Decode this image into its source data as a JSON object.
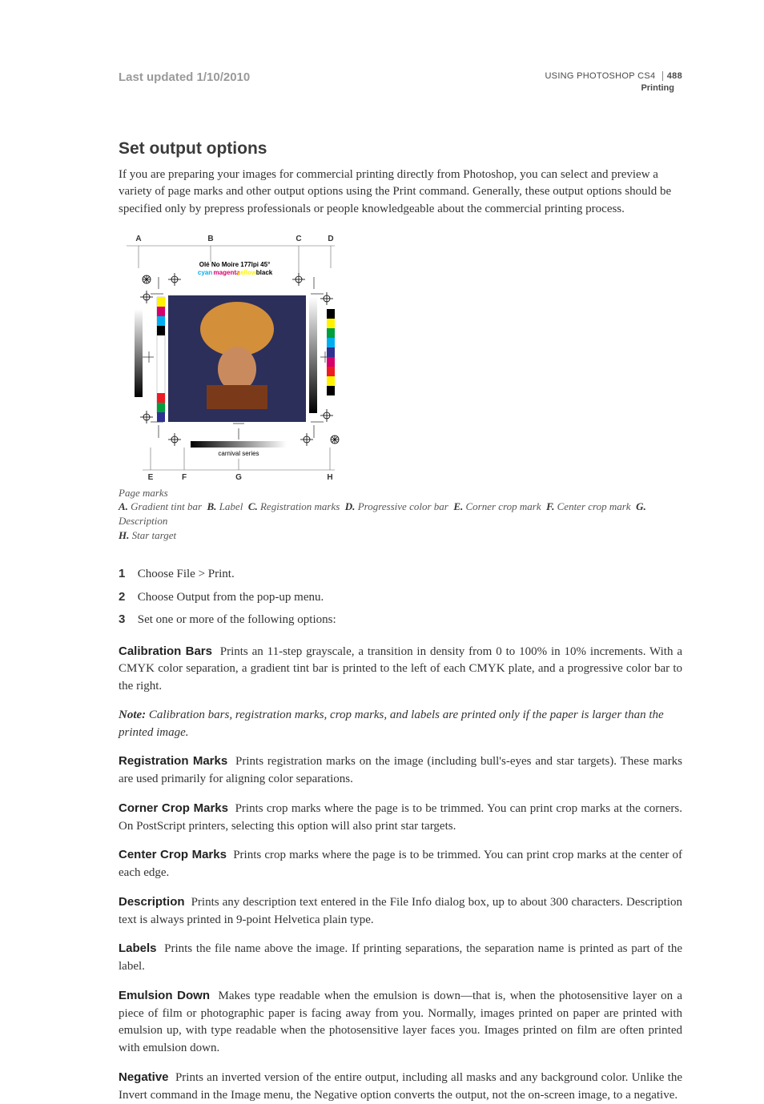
{
  "header": {
    "updated": "Last updated 1/10/2010",
    "doc_title": "USING PHOTOSHOP CS4",
    "page_number": "488",
    "section": "Printing"
  },
  "title": "Set output options",
  "intro": "If you are preparing your images for commercial printing directly from Photoshop, you can select and preview a variety of page marks and other output options using the Print command. Generally, these output options should be specified only by prepress professionals or people knowledgeable about the commercial printing process.",
  "figure": {
    "callouts_top": {
      "A": "A",
      "B": "B",
      "C": "C",
      "D": "D"
    },
    "callouts_bottom": {
      "E": "E",
      "F": "F",
      "G": "G",
      "H": "H"
    },
    "label_top": "Olé No Moire    177lpi   45°",
    "cmyk": {
      "c": "cyan",
      "m": "magenta",
      "y": "yellow",
      "k": "black"
    },
    "label_bottom": "carnival series"
  },
  "caption": {
    "title": "Page marks",
    "items": [
      {
        "letter": "A.",
        "text": "Gradient tint bar"
      },
      {
        "letter": "B.",
        "text": "Label"
      },
      {
        "letter": "C.",
        "text": "Registration marks"
      },
      {
        "letter": "D.",
        "text": "Progressive color bar"
      },
      {
        "letter": "E.",
        "text": "Corner crop mark"
      },
      {
        "letter": "F.",
        "text": "Center crop mark"
      },
      {
        "letter": "G.",
        "text": "Description"
      },
      {
        "letter": "H.",
        "text": "Star target"
      }
    ]
  },
  "steps": [
    {
      "n": "1",
      "text": "Choose File > Print."
    },
    {
      "n": "2",
      "text": "Choose Output from the pop-up menu."
    },
    {
      "n": "3",
      "text": "Set one or more of the following options:"
    }
  ],
  "options": {
    "calibration_bars": {
      "term": "Calibration Bars",
      "body": "Prints an 11-step grayscale, a transition in density from 0 to 100% in 10% increments. With a CMYK color separation, a gradient tint bar is printed to the left of each CMYK plate, and a progressive color bar to the right."
    },
    "note": "Calibration bars, registration marks, crop marks, and labels are printed only if the paper is larger than the printed image.",
    "registration_marks": {
      "term": "Registration Marks",
      "body": "Prints registration marks on the image (including bull's-eyes and star targets). These marks are used primarily for aligning color separations."
    },
    "corner_crop": {
      "term": "Corner Crop Marks",
      "body": "Prints crop marks where the page is to be trimmed. You can print crop marks at the corners. On PostScript printers, selecting this option will also print star targets."
    },
    "center_crop": {
      "term": "Center Crop Marks",
      "body": "Prints crop marks where the page is to be trimmed. You can print crop marks at the center of each edge."
    },
    "description": {
      "term": "Description",
      "body": "Prints any description text entered in the File Info dialog box, up to about 300 characters. Description text is always printed in 9-point Helvetica plain type."
    },
    "labels": {
      "term": "Labels",
      "body": "Prints the file name above the image. If printing separations, the separation name is printed as part of the label."
    },
    "emulsion": {
      "term": "Emulsion Down",
      "body": "Makes type readable when the emulsion is down—that is, when the photosensitive layer on a piece of film or photographic paper is facing away from you. Normally, images printed on paper are printed with emulsion up, with type readable when the photosensitive layer faces you. Images printed on film are often printed with emulsion down."
    },
    "negative": {
      "term": "Negative",
      "body": "Prints an inverted version of the entire output, including all masks and any background color. Unlike the Invert command in the Image menu, the Negative option converts the output, not the on-screen image, to a negative."
    }
  }
}
